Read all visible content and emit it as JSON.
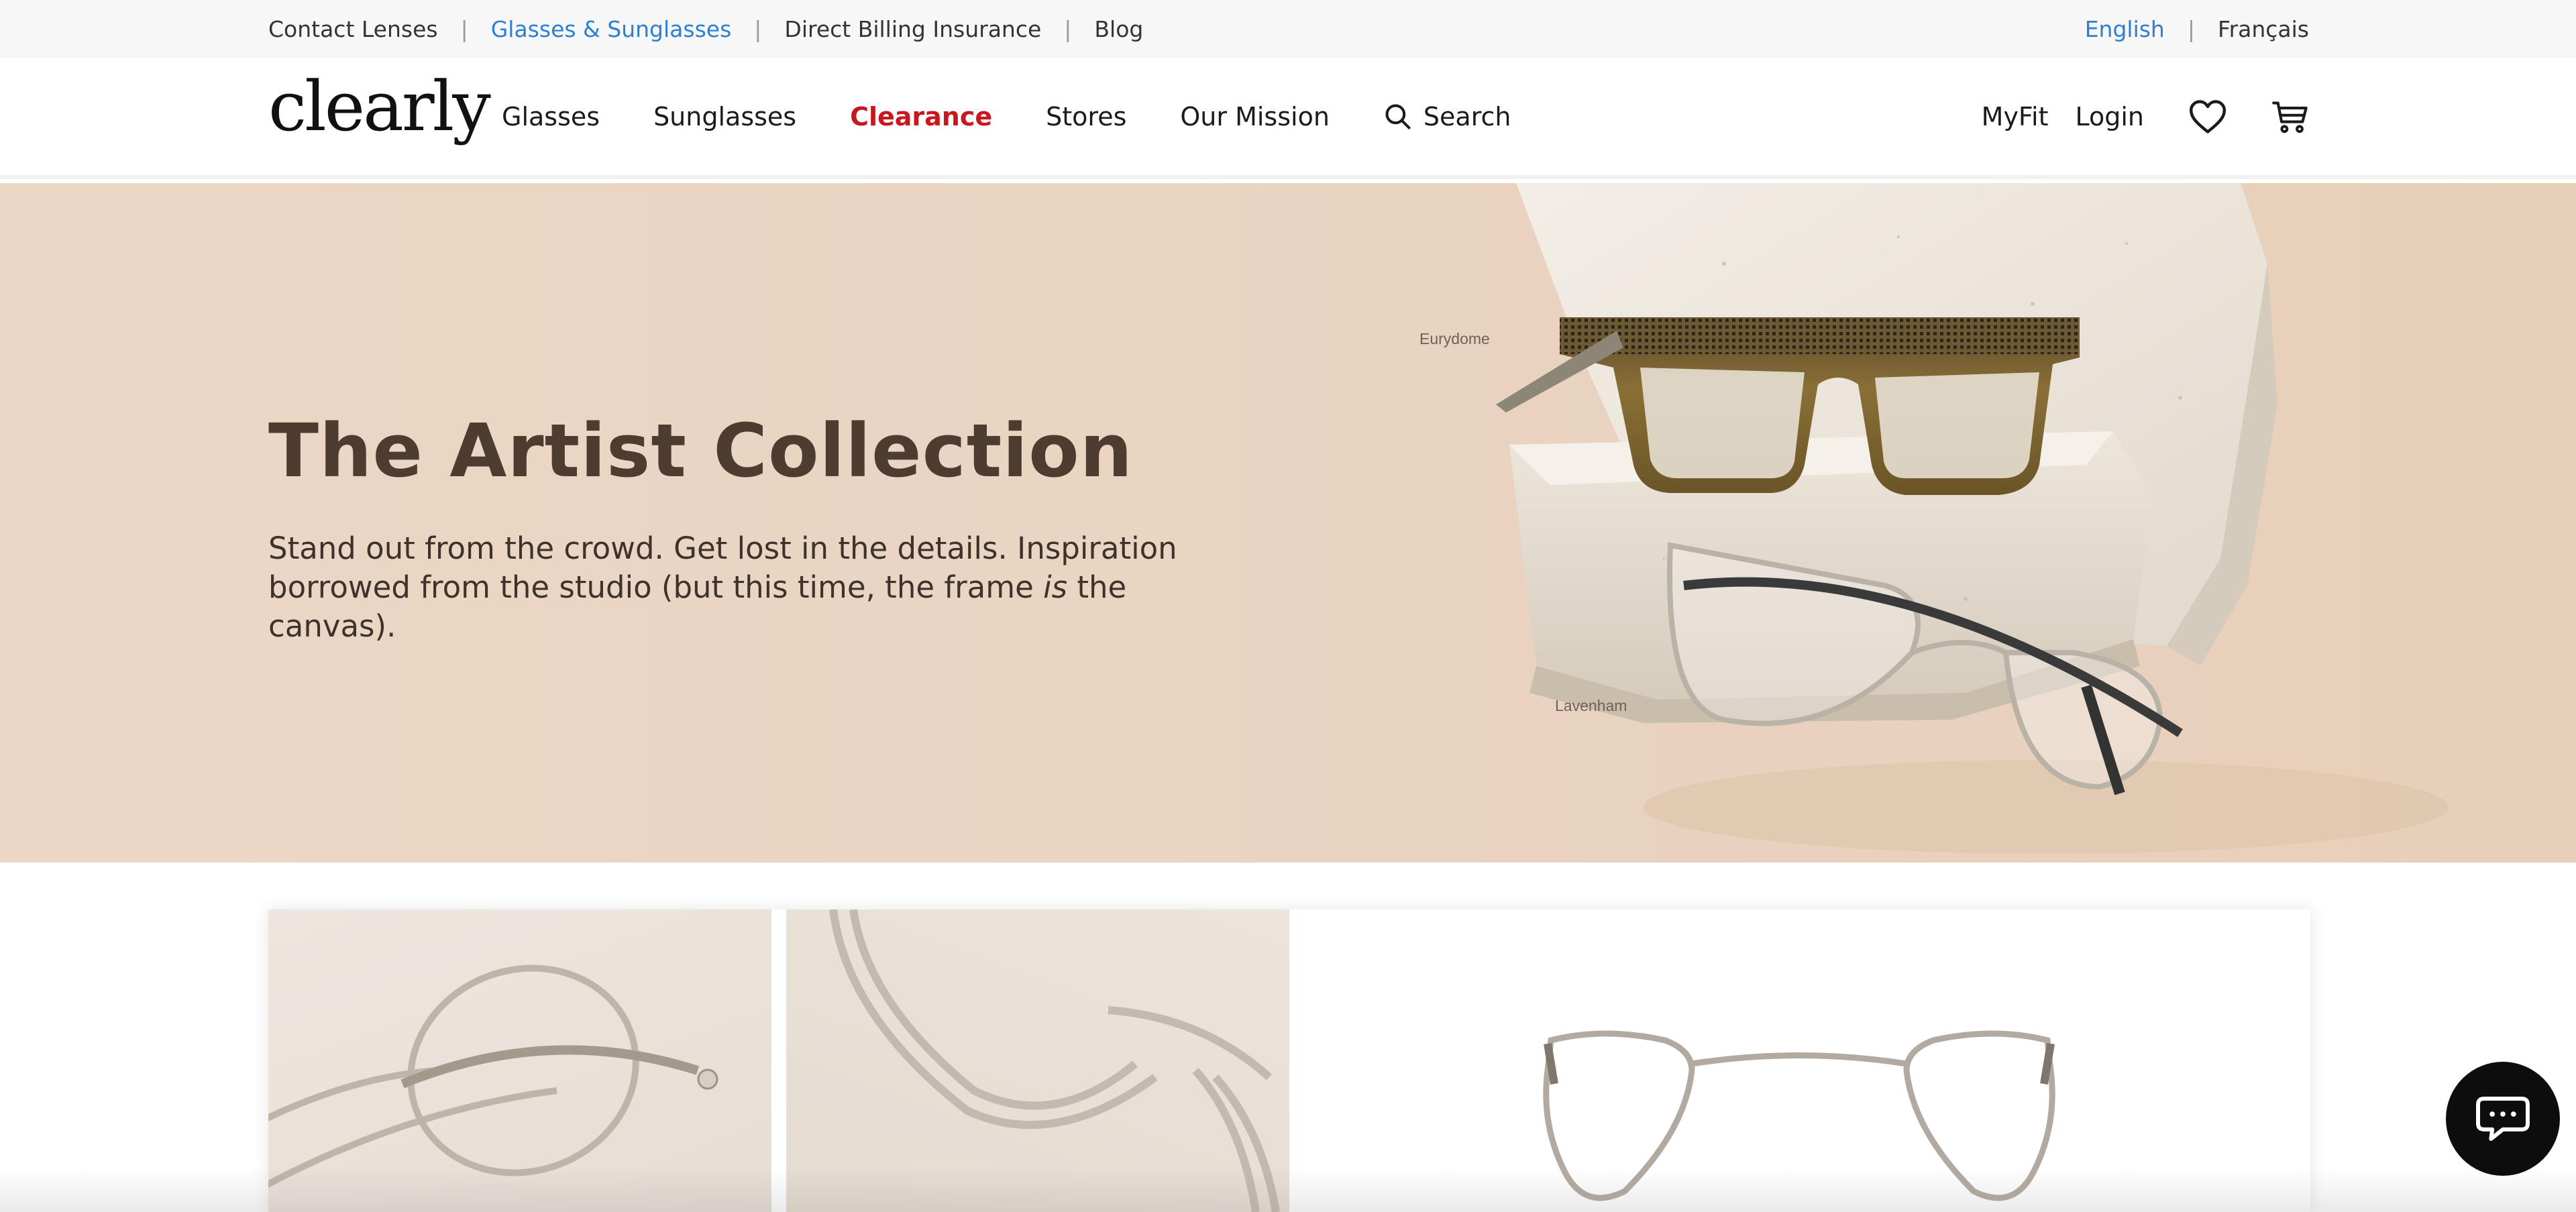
{
  "utility_bar": {
    "left_links": [
      {
        "label": "Contact Lenses"
      },
      {
        "label": "Glasses & Sunglasses"
      },
      {
        "label": "Direct Billing Insurance"
      },
      {
        "label": "Blog"
      }
    ],
    "separator": "|",
    "languages": [
      {
        "label": "English"
      },
      {
        "label": "Français"
      }
    ]
  },
  "header": {
    "logo": "clearly",
    "nav": {
      "glasses": "Glasses",
      "sunglasses": "Sunglasses",
      "clearance": "Clearance",
      "stores": "Stores",
      "our_mission": "Our Mission",
      "search": "Search"
    },
    "right": {
      "myfit": "MyFit",
      "login": "Login",
      "wishlist_icon": "heart-icon",
      "cart_icon": "cart-icon"
    }
  },
  "hero": {
    "title": "The Artist Collection",
    "text_part1": "Stand out from the crowd. Get lost in the details. Inspiration borrowed from the studio (but this time, the frame ",
    "text_emphasis": "is",
    "text_part2": " the canvas).",
    "frame_labels": {
      "top": "Eurydome",
      "bottom": "Lavenham"
    }
  },
  "chat": {
    "icon": "chat-bubble-icon"
  },
  "colors": {
    "accent_link": "#2d7fd1",
    "clearance": "#c8171e",
    "hero_bg": "#ecd7c6",
    "hero_title": "#4e3c31",
    "chat_bg": "#0d0d0d"
  }
}
